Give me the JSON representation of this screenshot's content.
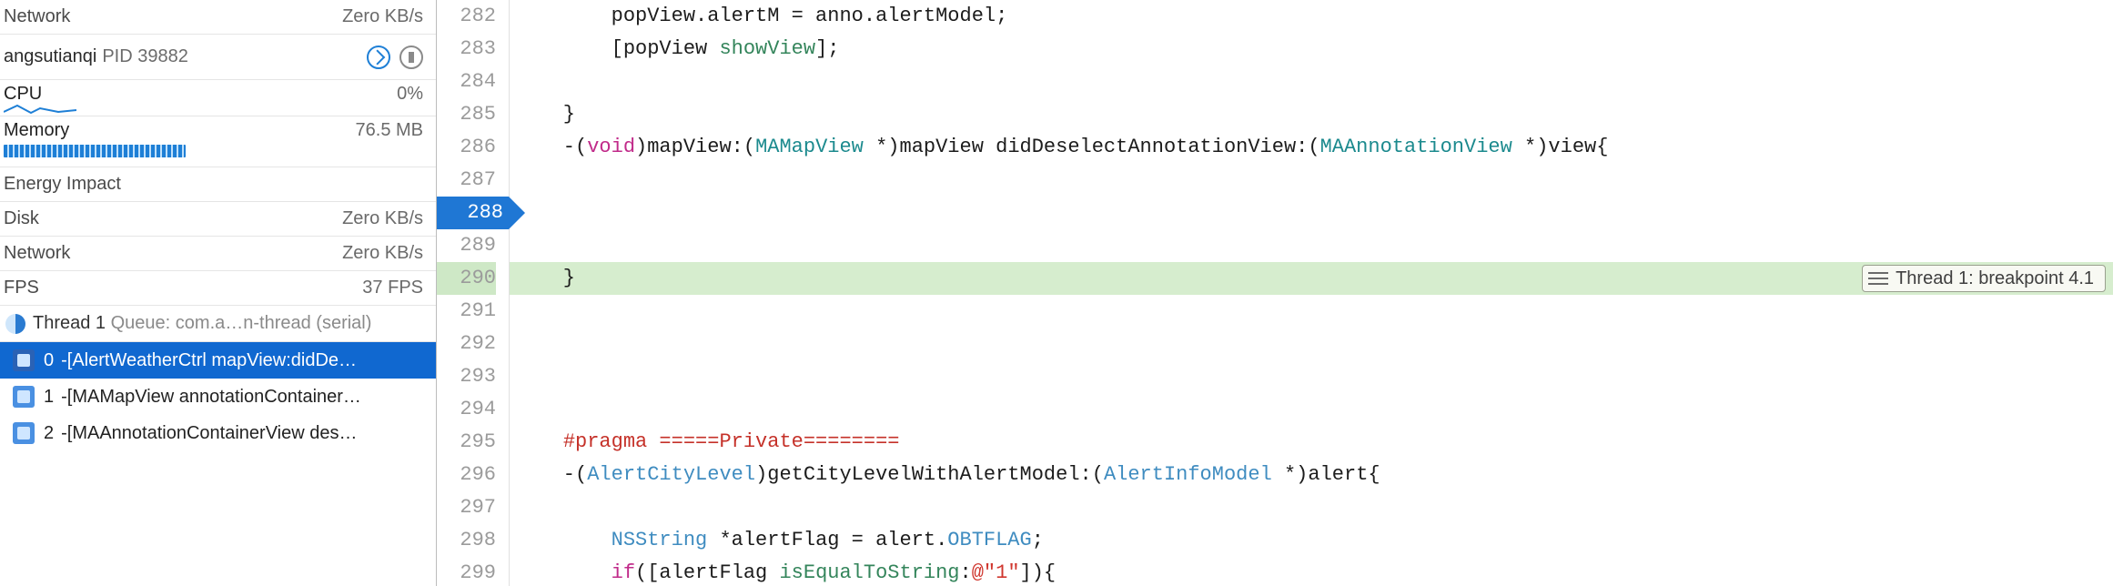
{
  "sidebar": {
    "gauges": {
      "network_top": {
        "label": "Network",
        "value": "Zero KB/s"
      },
      "cpu": {
        "label": "CPU",
        "value": "0%"
      },
      "memory": {
        "label": "Memory",
        "value": "76.5 MB"
      },
      "energy": {
        "label": "Energy Impact"
      },
      "disk": {
        "label": "Disk",
        "value": "Zero KB/s"
      },
      "network_bottom": {
        "label": "Network",
        "value": "Zero KB/s"
      },
      "fps": {
        "label": "FPS",
        "value": "37 FPS"
      }
    },
    "process": {
      "name": "angsutianqi",
      "pid_label": "PID 39882"
    },
    "thread": {
      "label": "Thread 1",
      "queue": " Queue: com.a…n-thread (serial)"
    },
    "frames": [
      {
        "num": "0",
        "label": "-[AlertWeatherCtrl mapView:didDe…"
      },
      {
        "num": "1",
        "label": "-[MAMapView annotationContainer…"
      },
      {
        "num": "2",
        "label": "-[MAAnnotationContainerView des…"
      }
    ]
  },
  "editor": {
    "first_line_number": 282,
    "breakpoint_line_number": 288,
    "highlight_line_number": 290,
    "breakpoint_tag": "Thread 1: breakpoint 4.1",
    "lines": [
      {
        "n": 282,
        "tokens": [
          [
            "plain",
            "        popView."
          ],
          [
            "plain",
            "alertM"
          ],
          [
            "plain",
            " = anno."
          ],
          [
            "plain",
            "alertModel"
          ],
          [
            "plain",
            ";"
          ]
        ]
      },
      {
        "n": 283,
        "tokens": [
          [
            "plain",
            "        [popView "
          ],
          [
            "msg",
            "showView"
          ],
          [
            "plain",
            "];"
          ]
        ]
      },
      {
        "n": 284,
        "tokens": [
          [
            "plain",
            ""
          ]
        ]
      },
      {
        "n": 285,
        "tokens": [
          [
            "plain",
            "    }"
          ]
        ]
      },
      {
        "n": 286,
        "tokens": [
          [
            "plain",
            "    -("
          ],
          [
            "kw",
            "void"
          ],
          [
            "plain",
            ")mapView:("
          ],
          [
            "type",
            "MAMapView"
          ],
          [
            "plain",
            " *)mapView didDeselectAnnotationView:("
          ],
          [
            "type",
            "MAAnnotationView"
          ],
          [
            "plain",
            " *)view{"
          ]
        ]
      },
      {
        "n": 287,
        "tokens": [
          [
            "plain",
            ""
          ]
        ]
      },
      {
        "n": 288,
        "tokens": [
          [
            "plain",
            ""
          ]
        ]
      },
      {
        "n": 289,
        "tokens": [
          [
            "plain",
            ""
          ]
        ]
      },
      {
        "n": 290,
        "tokens": [
          [
            "plain",
            "    }"
          ]
        ]
      },
      {
        "n": 291,
        "tokens": [
          [
            "plain",
            ""
          ]
        ]
      },
      {
        "n": 292,
        "tokens": [
          [
            "plain",
            ""
          ]
        ]
      },
      {
        "n": 293,
        "tokens": [
          [
            "plain",
            ""
          ]
        ]
      },
      {
        "n": 294,
        "tokens": [
          [
            "plain",
            ""
          ]
        ]
      },
      {
        "n": 295,
        "tokens": [
          [
            "plain",
            "    "
          ],
          [
            "pragma",
            "#pragma =====Private========"
          ]
        ]
      },
      {
        "n": 296,
        "tokens": [
          [
            "plain",
            "    -("
          ],
          [
            "usr",
            "AlertCityLevel"
          ],
          [
            "plain",
            ")getCityLevelWithAlertModel:("
          ],
          [
            "usr",
            "AlertInfoModel"
          ],
          [
            "plain",
            " *)alert{"
          ]
        ]
      },
      {
        "n": 297,
        "tokens": [
          [
            "plain",
            ""
          ]
        ]
      },
      {
        "n": 298,
        "tokens": [
          [
            "plain",
            "        "
          ],
          [
            "usr",
            "NSString"
          ],
          [
            "plain",
            " *alertFlag = alert."
          ],
          [
            "usr",
            "OBTFLAG"
          ],
          [
            "plain",
            ";"
          ]
        ]
      },
      {
        "n": 299,
        "tokens": [
          [
            "plain",
            "        "
          ],
          [
            "kw",
            "if"
          ],
          [
            "plain",
            "([alertFlag "
          ],
          [
            "msg",
            "isEqualToString"
          ],
          [
            "plain",
            ":"
          ],
          [
            "str",
            "@\"1\""
          ],
          [
            "plain",
            "]){"
          ]
        ]
      }
    ]
  }
}
